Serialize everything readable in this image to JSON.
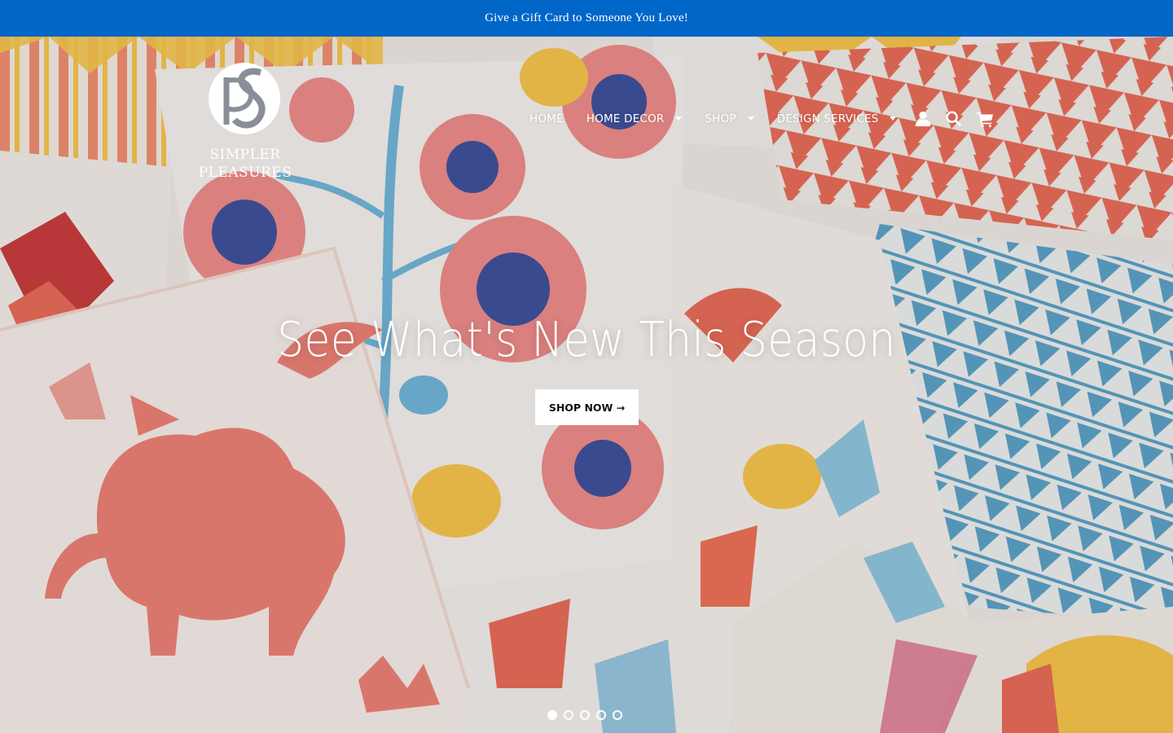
{
  "announcement": {
    "text": "Give a Gift Card to Someone You Love!"
  },
  "brand": {
    "logo_text": "SIMPLER PLEASURES"
  },
  "nav": {
    "items": [
      {
        "label": "HOME",
        "dropdown": false
      },
      {
        "label": "HOME DECOR",
        "dropdown": true
      },
      {
        "label": "SHOP",
        "dropdown": true
      },
      {
        "label": "DESIGN SERVICES",
        "dropdown": true
      }
    ],
    "icons": [
      "account-icon",
      "search-icon",
      "cart-icon"
    ]
  },
  "hero": {
    "title": "See What's New This Season",
    "button_label": "SHOP NOW →",
    "slides": {
      "count": 5,
      "active_index": 0
    }
  },
  "colors": {
    "announcement_bg": "#0066c8",
    "text": "#ffffff",
    "button_bg": "#ffffff",
    "button_text": "#111111"
  }
}
